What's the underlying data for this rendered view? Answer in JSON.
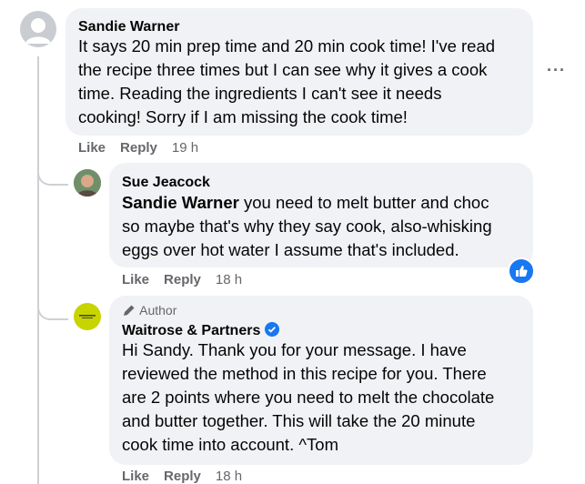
{
  "comments": [
    {
      "author": "Sandie Warner",
      "lines": [
        "It says 20 min prep time and 20 min cook time! I've read",
        "the recipe three times but I can see why it gives a cook",
        "time. Reading the ingredients I can't see it needs",
        "cooking! Sorry if I am missing the cook time!"
      ],
      "like": "Like",
      "reply": "Reply",
      "time": "19 h"
    },
    {
      "author": "Sue Jeacock",
      "mention": "Sandie Warner",
      "first_line_rest": " you need to melt butter and choc",
      "lines": [
        "so maybe that's why they say cook, also-whisking",
        "eggs over hot water I assume that's included."
      ],
      "like": "Like",
      "reply": "Reply",
      "time": "18 h"
    },
    {
      "badge": "Author",
      "author": "Waitrose & Partners",
      "verified": true,
      "lines": [
        "Hi Sandy. Thank you for your message. I have",
        "reviewed the method in this recipe for you. There",
        "are 2 points where you need to melt the chocolate",
        "and butter together. This will take the 20 minute",
        "cook time into account. ^Tom"
      ],
      "like": "Like",
      "reply": "Reply",
      "time": "18 h"
    }
  ],
  "more_options": "···",
  "colors": {
    "bubble": "#f0f2f5",
    "like_reaction": "#1877f2",
    "verified": "#1877f2",
    "waitrose_logo": "#c8d400"
  }
}
